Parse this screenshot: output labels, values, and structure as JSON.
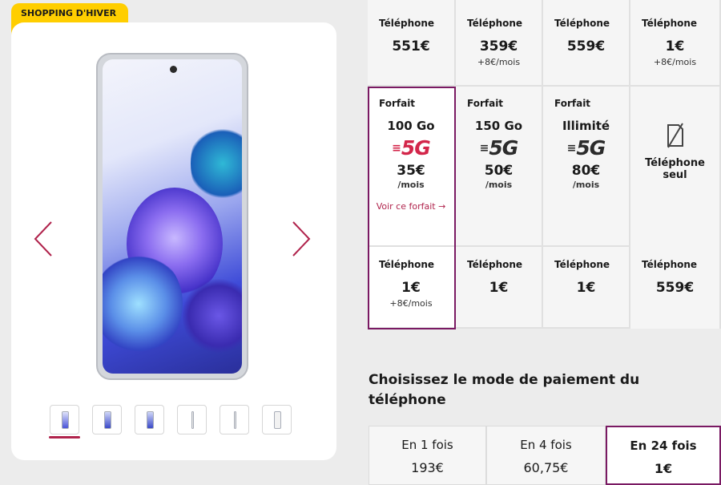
{
  "badge": "SHOPPING D'HIVER",
  "gallery": {
    "thumbnail_count": 6,
    "active_thumbnail": 1
  },
  "top_row": [
    {
      "label": "Téléphone",
      "price": "551€",
      "sub": ""
    },
    {
      "label": "Téléphone",
      "price": "359€",
      "sub": "+8€/mois"
    },
    {
      "label": "Téléphone",
      "price": "559€",
      "sub": ""
    },
    {
      "label": "Téléphone",
      "price": "1€",
      "sub": "+8€/mois"
    }
  ],
  "forfaits": [
    {
      "label": "Forfait",
      "data": "100 Go",
      "network": "5G",
      "price": "35€",
      "per": "/mois",
      "link": "Voir ce forfait",
      "selected": true,
      "accent": "#d3264a"
    },
    {
      "label": "Forfait",
      "data": "150 Go",
      "network": "5G",
      "price": "50€",
      "per": "/mois",
      "link": "",
      "selected": false,
      "accent": "#2b2b2b"
    },
    {
      "label": "Forfait",
      "data": "Illimité",
      "network": "5G",
      "price": "80€",
      "per": "/mois",
      "link": "",
      "selected": false,
      "accent": "#2b2b2b"
    },
    {
      "label": "",
      "data": "Téléphone seul",
      "network": "",
      "price": "",
      "per": "",
      "link": "",
      "selected": false,
      "accent": "#2b2b2b",
      "icon": "no-sim-icon"
    }
  ],
  "bottom_row": [
    {
      "label": "Téléphone",
      "price": "1€",
      "sub": "+8€/mois"
    },
    {
      "label": "Téléphone",
      "price": "1€",
      "sub": ""
    },
    {
      "label": "Téléphone",
      "price": "1€",
      "sub": ""
    },
    {
      "label": "Téléphone",
      "price": "559€",
      "sub": ""
    }
  ],
  "payment": {
    "title": "Choisissez le mode de paiement du téléphone",
    "options": [
      {
        "label": "En 1 fois",
        "value": "193€",
        "selected": false
      },
      {
        "label": "En 4 fois",
        "value": "60,75€",
        "selected": false
      },
      {
        "label": "En 24 fois",
        "value": "1€",
        "selected": true
      }
    ]
  },
  "colors": {
    "brand": "#d3264a",
    "selection": "#7a1a63",
    "badge": "#ffce00"
  }
}
